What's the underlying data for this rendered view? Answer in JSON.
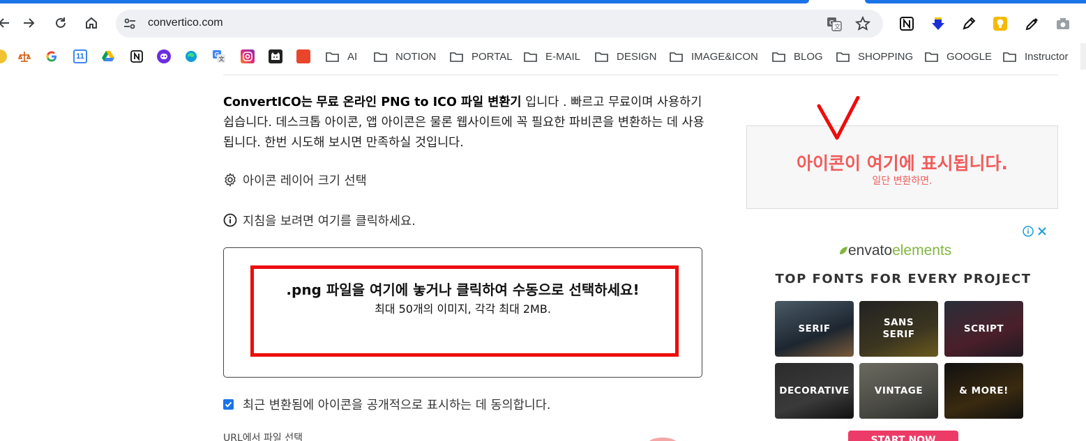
{
  "browser": {
    "url": "convertico.com",
    "bookmarks": {
      "folders": [
        "AI",
        "NOTION",
        "PORTAL",
        "E-MAIL",
        "DESIGN",
        "IMAGE&ICON",
        "BLOG",
        "SHOPPING",
        "GOOGLE",
        "Instructor"
      ],
      "calendar_icon_text": "11"
    }
  },
  "page": {
    "intro": {
      "brand": "ConvertICO는",
      "bold_phrase": "무료 온라인 PNG to ICO 파일 변환기",
      "rest": " 입니다 . 빠르고 무료이며 사용하기 쉽습니다. 데스크톱 아이콘, 앱 아이콘은 물론 웹사이트에 꼭 필요한 파비콘을 변환하는 데 사용됩니다. 한번 시도해 보시면 만족하실 것입니다."
    },
    "layer_size_label": "아이콘 레이어 크기 선택",
    "guide_label": "지침을 보려면 여기를 클릭하세요.",
    "dropzone": {
      "title": ".png 파일을 여기에 놓거나 클릭하여 수동으로 선택하세요!",
      "subtitle": "최대 50개의 이미지, 각각 최대 2MB."
    },
    "consent_label": "최근 변환됨에 아이콘을 공개적으로 표시하는 데 동의합니다.",
    "consent_checked": true,
    "url_select_label": "URL에서 파일 선택",
    "preview": {
      "title": "아이콘이 여기에 표시됩니다.",
      "subtitle": "일단 변환하면."
    },
    "ad": {
      "brand_envato": "envato",
      "brand_elements": "elements",
      "headline": "TOP FONTS FOR EVERY PROJECT",
      "tiles": [
        "SERIF",
        "SANS SERIF",
        "SCRIPT",
        "DECORATIVE",
        "VINTAGE",
        "& MORE!"
      ],
      "cta": "START NOW"
    }
  },
  "colors": {
    "accent": "#1a73e8",
    "highlight_red": "#ee0c0c",
    "preview_text": "#f25b5b",
    "ad_cta": "#ed3b68"
  }
}
